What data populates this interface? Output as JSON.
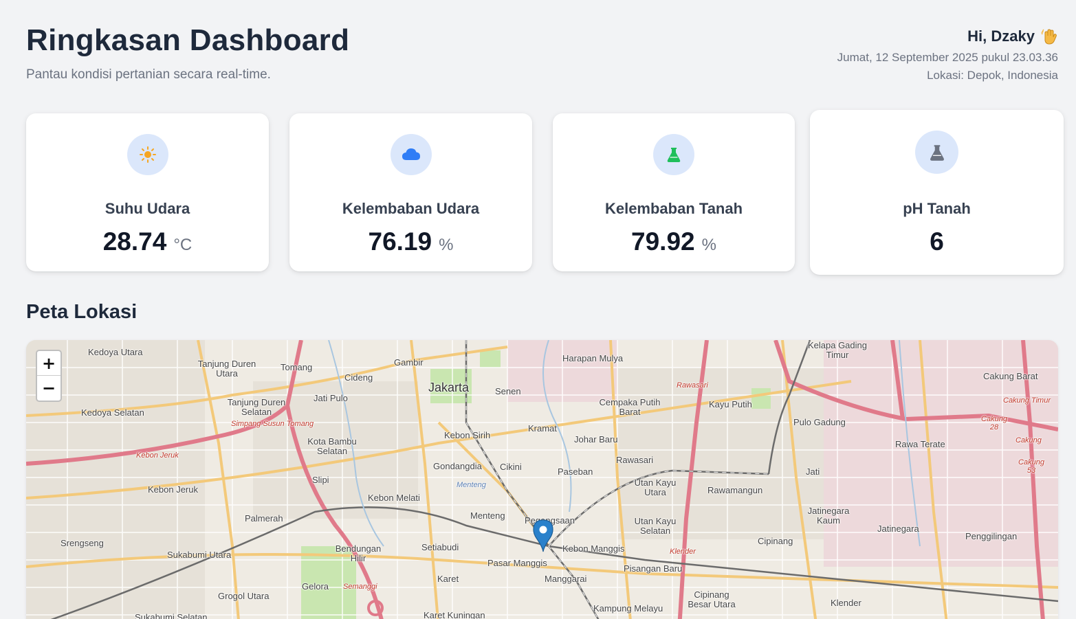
{
  "header": {
    "title": "Ringkasan Dashboard",
    "subtitle": "Pantau kondisi pertanian secara real-time.",
    "greeting": "Hi, Dzaky",
    "greeting_icon": "waving-hand-icon",
    "datetime": "Jumat, 12 September 2025 pukul 23.03.36",
    "location": "Lokasi: Depok, Indonesia"
  },
  "cards": [
    {
      "label": "Suhu Udara",
      "value": "28.74",
      "unit": "°C",
      "icon": "sun-icon",
      "icon_color": "#f5a623"
    },
    {
      "label": "Kelembaban Udara",
      "value": "76.19",
      "unit": "%",
      "icon": "cloud-icon",
      "icon_color": "#2f7df6"
    },
    {
      "label": "Kelembaban Tanah",
      "value": "79.92",
      "unit": "%",
      "icon": "flask-icon",
      "icon_color": "#1fbf5b"
    },
    {
      "label": "pH Tanah",
      "value": "6",
      "unit": "",
      "icon": "flask-icon",
      "icon_color": "#6b7280"
    }
  ],
  "map": {
    "title": "Peta Lokasi",
    "zoom_in": "+",
    "zoom_out": "−",
    "marker_icon": "map-pin-icon",
    "places": [
      {
        "text": "Jakarta",
        "style": "big"
      },
      {
        "text": "Kedoya Utara"
      },
      {
        "text": "Tanjung Duren Utara"
      },
      {
        "text": "Tomang"
      },
      {
        "text": "Gambir"
      },
      {
        "text": "Cideng"
      },
      {
        "text": "Senen"
      },
      {
        "text": "Harapan Mulya"
      },
      {
        "text": "Kelapa Gading Timur"
      },
      {
        "text": "Cakung Barat"
      },
      {
        "text": "Cempaka Putih Barat"
      },
      {
        "text": "Kayu Putih"
      },
      {
        "text": "Pulo Gadung"
      },
      {
        "text": "Kedoya Selatan"
      },
      {
        "text": "Tanjung Duren Selatan"
      },
      {
        "text": "Jati Pulo"
      },
      {
        "text": "Kebon Sirih"
      },
      {
        "text": "Kramat"
      },
      {
        "text": "Johar Baru"
      },
      {
        "text": "Rawa Terate"
      },
      {
        "text": "Kota Bambu Selatan"
      },
      {
        "text": "Gondangdia"
      },
      {
        "text": "Cikini"
      },
      {
        "text": "Paseban"
      },
      {
        "text": "Rawasari"
      },
      {
        "text": "Jati"
      },
      {
        "text": "Kebon Jeruk"
      },
      {
        "text": "Slipi"
      },
      {
        "text": "Utan Kayu Utara"
      },
      {
        "text": "Rawamangun"
      },
      {
        "text": "Kebon Melati"
      },
      {
        "text": "Menteng"
      },
      {
        "text": "Pegangsaan"
      },
      {
        "text": "Jatinegara Kaum"
      },
      {
        "text": "Palmerah"
      },
      {
        "text": "Utan Kayu Selatan"
      },
      {
        "text": "Jatinegara"
      },
      {
        "text": "Srengseng"
      },
      {
        "text": "Bendungan Hilir"
      },
      {
        "text": "Setiabudi"
      },
      {
        "text": "Kebon Manggis"
      },
      {
        "text": "Cipinang"
      },
      {
        "text": "Penggilingan"
      },
      {
        "text": "Sukabumi Utara"
      },
      {
        "text": "Pasar Manggis"
      },
      {
        "text": "Pisangan Baru"
      },
      {
        "text": "Karet"
      },
      {
        "text": "Manggarai"
      },
      {
        "text": "Gelora"
      },
      {
        "text": "Grogol Utara"
      },
      {
        "text": "Cipinang Besar Utara"
      },
      {
        "text": "Klender"
      },
      {
        "text": "Karet Kuningan"
      },
      {
        "text": "Kampung Melayu"
      },
      {
        "text": "Sukabumi Selatan"
      }
    ],
    "road_labels": [
      {
        "text": "Simpang Susun Tomang"
      },
      {
        "text": "Kebon Jeruk"
      },
      {
        "text": "Rawasari"
      },
      {
        "text": "Cakung Timur"
      },
      {
        "text": "Cakung 28"
      },
      {
        "text": "Cakung"
      },
      {
        "text": "Cakung 53"
      },
      {
        "text": "Semanggi"
      },
      {
        "text": "Klender"
      },
      {
        "text": "Menteng"
      }
    ]
  }
}
